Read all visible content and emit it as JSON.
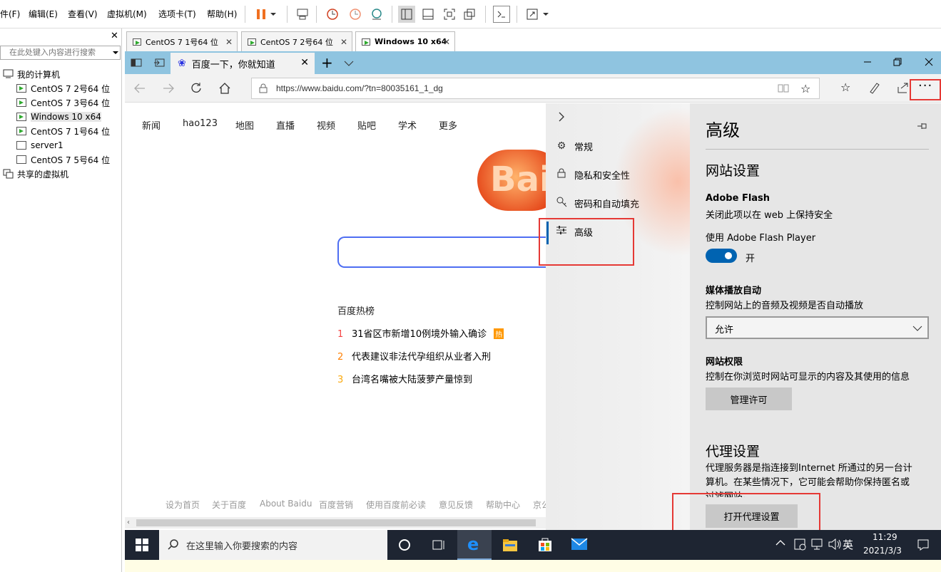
{
  "vmware": {
    "menu": [
      "件(F)",
      "编辑(E)",
      "查看(V)",
      "虚拟机(M)",
      "选项卡(T)",
      "帮助(H)"
    ]
  },
  "library": {
    "search_placeholder": "在此处键入内容进行搜索",
    "root": "我的计算机",
    "vms": [
      "CentOS 7 2号64 位",
      "CentOS 7 3号64 位",
      "Windows 10 x64",
      "CentOS 7 1号64 位",
      "server1",
      "CentOS 7 5号64 位"
    ],
    "shared": "共享的虚拟机",
    "close": "✕"
  },
  "vm_tabs": [
    "CentOS 7 1号64 位",
    "CentOS 7 2号64 位",
    "Windows 10 x64"
  ],
  "edge": {
    "tab_title": "百度一下，你就知道",
    "url": "https://www.baidu.com/?tn=80035161_1_dg"
  },
  "baidu": {
    "nav": [
      "新闻",
      "hao123",
      "地图",
      "直播",
      "视频",
      "贴吧",
      "学术",
      "更多"
    ],
    "logo": "Bai",
    "hot_title": "百度热榜",
    "hot": [
      {
        "num": "1",
        "text": "31省区市新增10例境外输入确诊",
        "badge": "热"
      },
      {
        "num": "2",
        "text": "代表建议非法代孕组织从业者入刑",
        "badge": ""
      },
      {
        "num": "3",
        "text": "台湾名嘴被大陆菠萝产量惊到",
        "badge": ""
      }
    ],
    "footer": [
      "设为首页",
      "关于百度",
      "About Baidu",
      "百度营销",
      "使用百度前必读",
      "意见反馈",
      "帮助中心",
      "京公"
    ]
  },
  "settings": {
    "nav": [
      "常规",
      "隐私和安全性",
      "密码和自动填充",
      "高级"
    ],
    "title": "高级",
    "site_settings": "网站设置",
    "flash_title": "Adobe Flash",
    "flash_desc": "关闭此项以在 web 上保持安全",
    "flash_use": "使用 Adobe Flash Player",
    "flash_state": "开",
    "autoplay_title": "媒体播放自动",
    "autoplay_desc": "控制网站上的音频及视频是否自动播放",
    "autoplay_value": "允许",
    "perm_title": "网站权限",
    "perm_desc": "控制在你浏览时网站可显示的内容及其使用的信息",
    "perm_button": "管理许可",
    "proxy_title": "代理设置",
    "proxy_desc1": "代理服务器是指连接到Internet 所通过的另一台计",
    "proxy_desc2": "算机。在某些情况下，它可能会帮助你保持匿名或",
    "proxy_desc3": "过滤网站。",
    "proxy_button": "打开代理设置"
  },
  "taskbar": {
    "search_placeholder": "在这里输入你要搜索的内容",
    "time": "11:29",
    "date": "2021/3/3",
    "lang": "英"
  }
}
